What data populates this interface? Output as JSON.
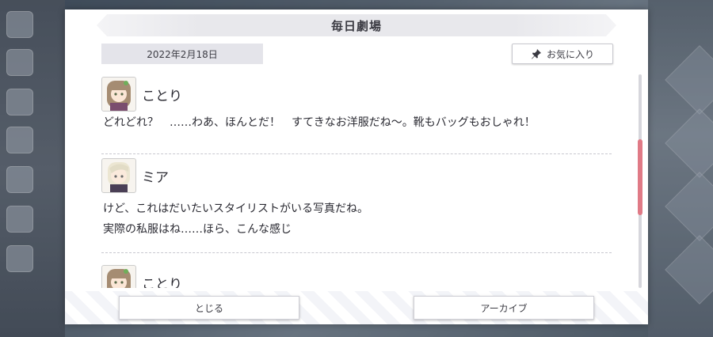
{
  "dialog": {
    "title": "毎日劇場",
    "date": "2022年2月18日",
    "favorite_label": "お気に入り",
    "close_label": "とじる",
    "archive_label": "アーカイブ"
  },
  "entries": [
    {
      "speaker": "ことり",
      "avatar": "kotori-avatar",
      "lines": [
        "どれどれ？　……わあ、ほんとだ！　すてきなお洋服だね～。靴もバッグもおしゃれ！"
      ]
    },
    {
      "speaker": "ミア",
      "avatar": "mia-avatar",
      "lines": [
        "けど、これはだいたいスタイリストがいる写真だね。",
        "実際の私服はね……ほら、こんな感じ"
      ]
    },
    {
      "speaker": "ことり",
      "avatar": "kotori-avatar",
      "lines": []
    }
  ],
  "icons": {
    "favorite": "pin-icon"
  },
  "colors": {
    "scroll_thumb": "#e07a86",
    "title_bg": "#e8e8ec",
    "date_bg": "#e4e4ea"
  }
}
